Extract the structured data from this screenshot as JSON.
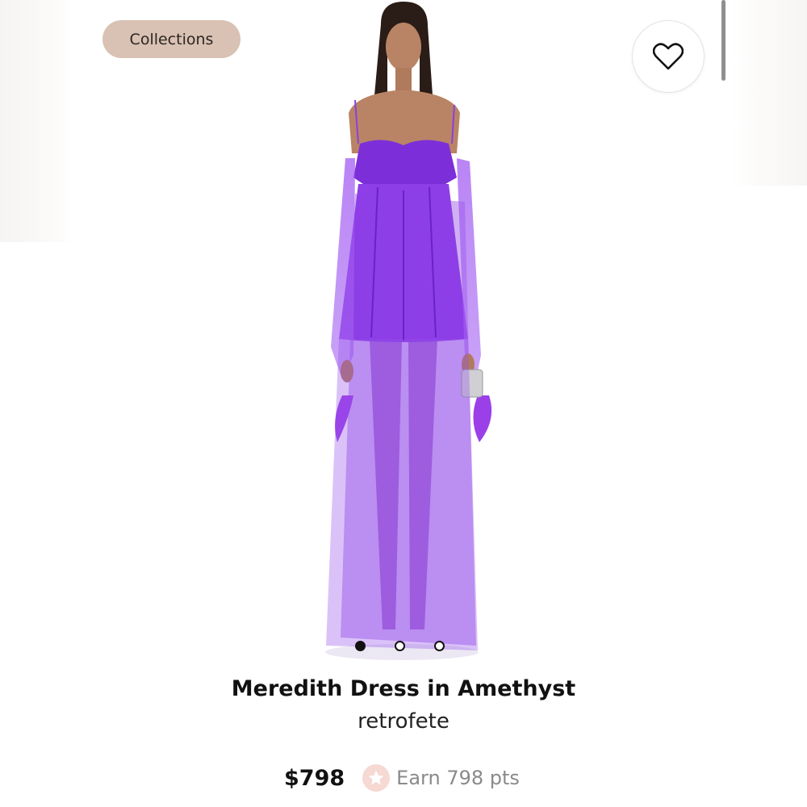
{
  "header": {
    "collections_label": "Collections",
    "favorite_icon": "heart-icon"
  },
  "gallery": {
    "image_description": "Model wearing sheer purple off-shoulder maxi dress",
    "slide_count": 3,
    "active_slide": 1
  },
  "product": {
    "title": "Meredith Dress in Amethyst",
    "brand": "retrofete",
    "price": "$798",
    "points_label": "Earn 798 pts",
    "points_icon": "star-icon"
  },
  "colors": {
    "chip_background": "#d9c2b3",
    "dress_purple": "#8a3fe0",
    "points_badge": "#f6d9d3"
  }
}
